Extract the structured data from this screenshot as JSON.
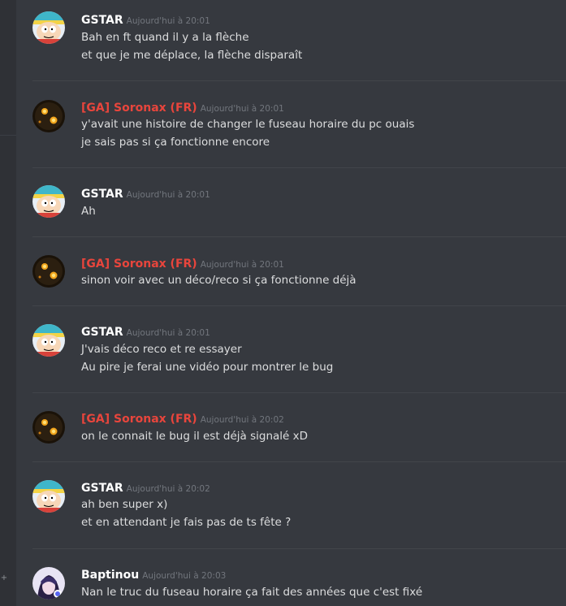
{
  "left_panel": {
    "add_icon": "+"
  },
  "messages": [
    {
      "author": "GSTAR",
      "timestamp": "Aujourd'hui à 20:01",
      "avatar": "cartman-avatar",
      "author_color": "#ffffff",
      "lines": [
        "Bah en ft quand il y a la flèche",
        "et que je me déplace, la flèche disparaît"
      ]
    },
    {
      "author": "[GA] Soronax (FR)",
      "timestamp": "Aujourd'hui à 20:01",
      "avatar": "glowing-eyes-avatar",
      "author_color": "#e8453c",
      "lines": [
        "y'avait une histoire de changer le fuseau horaire du pc ouais",
        "je sais pas si ça fonctionne encore"
      ]
    },
    {
      "author": "GSTAR",
      "timestamp": "Aujourd'hui à 20:01",
      "avatar": "cartman-avatar",
      "author_color": "#ffffff",
      "lines": [
        "Ah"
      ]
    },
    {
      "author": "[GA] Soronax (FR)",
      "timestamp": "Aujourd'hui à 20:01",
      "avatar": "glowing-eyes-avatar",
      "author_color": "#e8453c",
      "lines": [
        "sinon voir avec un déco/reco si ça fonctionne déjà"
      ]
    },
    {
      "author": "GSTAR",
      "timestamp": "Aujourd'hui à 20:01",
      "avatar": "cartman-avatar",
      "author_color": "#ffffff",
      "lines": [
        "J'vais déco reco et re essayer",
        "Au pire je ferai une vidéo pour montrer le bug"
      ]
    },
    {
      "author": "[GA] Soronax (FR)",
      "timestamp": "Aujourd'hui à 20:02",
      "avatar": "glowing-eyes-avatar",
      "author_color": "#e8453c",
      "lines": [
        "on le connait le bug il est déjà signalé xD"
      ]
    },
    {
      "author": "GSTAR",
      "timestamp": "Aujourd'hui à 20:02",
      "avatar": "cartman-avatar",
      "author_color": "#ffffff",
      "lines": [
        "ah ben super x)",
        "et en attendant je fais pas de ts fête ?"
      ]
    },
    {
      "author": "Baptinou",
      "timestamp": "Aujourd'hui à 20:03",
      "avatar": "anime-avatar",
      "author_color": "#ffffff",
      "lines": [
        "Nan le truc du fuseau horaire ça fait des années que c'est fixé"
      ]
    }
  ]
}
